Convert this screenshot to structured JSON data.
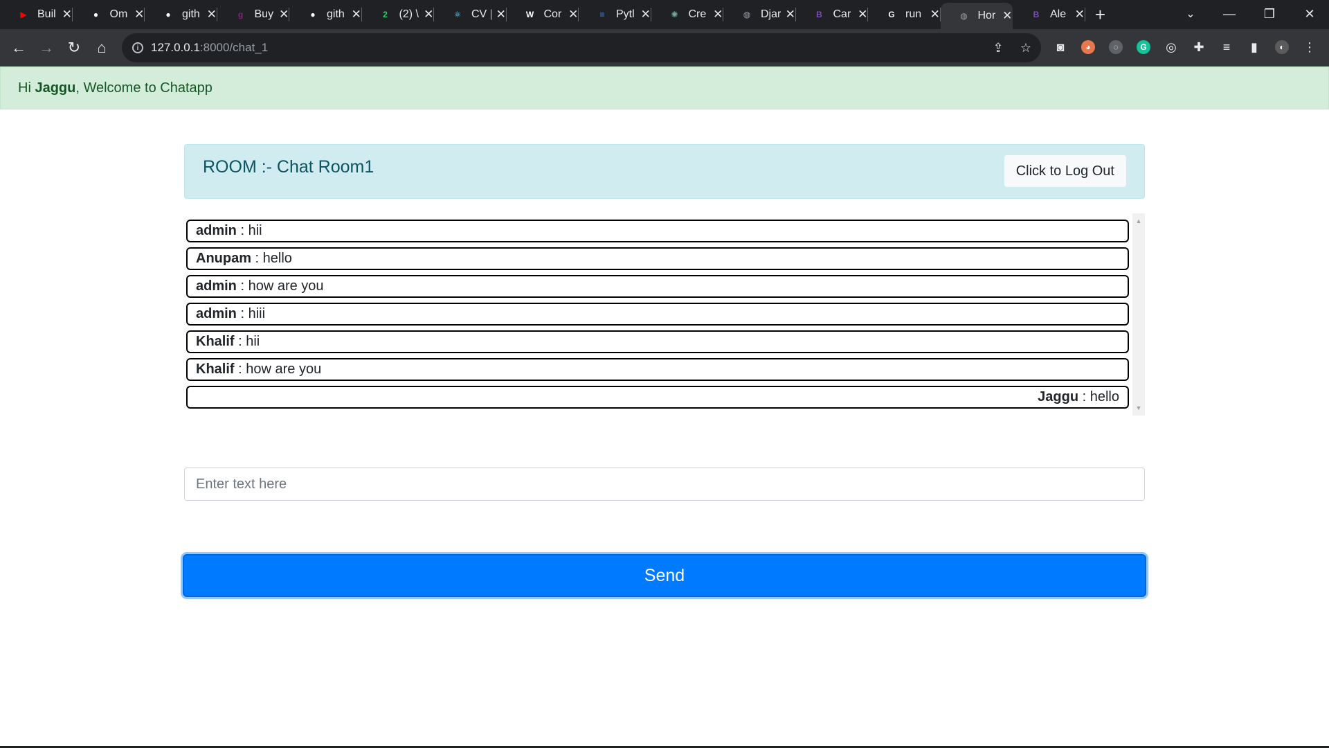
{
  "browser": {
    "tabs": [
      {
        "title": "Buil",
        "icon": "youtube-icon",
        "color": "#ff0000",
        "glyph": "▶"
      },
      {
        "title": "Om",
        "icon": "github-icon",
        "color": "#ffffff",
        "glyph": "●"
      },
      {
        "title": "gith",
        "icon": "github-icon",
        "color": "#ffffff",
        "glyph": "●"
      },
      {
        "title": "Buy",
        "icon": "buy-site-icon",
        "color": "#8b1f7a",
        "glyph": "g"
      },
      {
        "title": "gith",
        "icon": "github-icon",
        "color": "#ffffff",
        "glyph": "●"
      },
      {
        "title": "(2) \\",
        "icon": "whatsapp-icon",
        "color": "#25d366",
        "glyph": "2"
      },
      {
        "title": "CV |",
        "icon": "react-icon",
        "color": "#61dafb",
        "glyph": "⚛"
      },
      {
        "title": "Cor",
        "icon": "wordpress-icon",
        "color": "#ffffff",
        "glyph": "W"
      },
      {
        "title": "Pytl",
        "icon": "google-docs-icon",
        "color": "#4285f4",
        "glyph": "≡"
      },
      {
        "title": "Cre",
        "icon": "chatgpt-icon",
        "color": "#74aa9c",
        "glyph": "✺"
      },
      {
        "title": "Djar",
        "icon": "globe-icon",
        "color": "#9aa0a6",
        "glyph": "◍"
      },
      {
        "title": "Car",
        "icon": "bootstrap-icon",
        "color": "#7952b3",
        "glyph": "B"
      },
      {
        "title": "run",
        "icon": "google-icon",
        "color": "#ffffff",
        "glyph": "G"
      },
      {
        "title": "Hor",
        "icon": "globe-icon",
        "color": "#9aa0a6",
        "glyph": "◍",
        "active": true
      },
      {
        "title": "Ale",
        "icon": "bootstrap-icon",
        "color": "#7952b3",
        "glyph": "B"
      }
    ],
    "url_host": "127.0.0.1",
    "url_path": ":8000/chat_1"
  },
  "welcome": {
    "prefix": "Hi ",
    "username": "Jaggu",
    "suffix": ", Welcome to Chatapp"
  },
  "room": {
    "title": "ROOM :- Chat Room1",
    "logout_label": "Click to Log Out"
  },
  "messages": [
    {
      "user": "admin",
      "text": " : hii",
      "align": "left"
    },
    {
      "user": "Anupam",
      "text": " : hello",
      "align": "left"
    },
    {
      "user": "admin",
      "text": " : how are you",
      "align": "left"
    },
    {
      "user": "admin",
      "text": " : hiii",
      "align": "left"
    },
    {
      "user": "Khalif",
      "text": " : hii",
      "align": "left"
    },
    {
      "user": "Khalif",
      "text": " : how are you",
      "align": "left"
    },
    {
      "user": "Jaggu",
      "text": " : hello",
      "align": "right"
    }
  ],
  "composer": {
    "placeholder": "Enter text here",
    "send_label": "Send"
  },
  "colors": {
    "primary": "#007bff",
    "success_bg": "#d4edda",
    "info_bg": "#d1ecf1"
  }
}
